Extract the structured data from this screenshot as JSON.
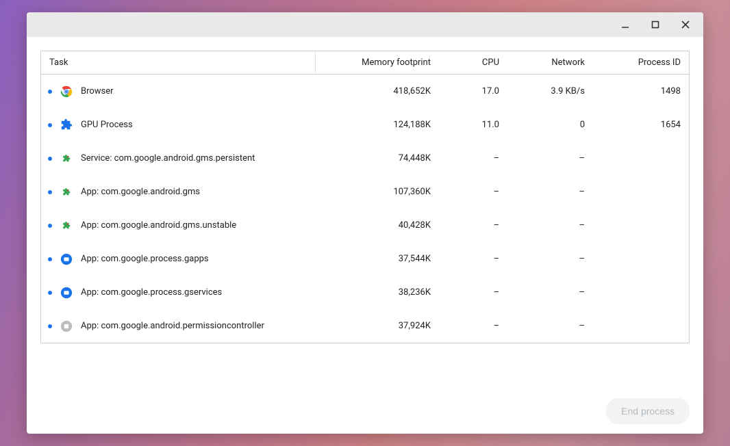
{
  "columns": {
    "task": "Task",
    "memory": "Memory footprint",
    "cpu": "CPU",
    "network": "Network",
    "pid": "Process ID"
  },
  "rows": [
    {
      "icon": "chrome",
      "name": "Browser",
      "memory": "418,652K",
      "cpu": "17.0",
      "network": "3.9 KB/s",
      "pid": "1498"
    },
    {
      "icon": "puzzle",
      "name": "GPU Process",
      "memory": "124,188K",
      "cpu": "11.0",
      "network": "0",
      "pid": "1654"
    },
    {
      "icon": "mini-puzzle",
      "name": "Service: com.google.android.gms.persistent",
      "memory": "74,448K",
      "cpu": "–",
      "network": "–",
      "pid": ""
    },
    {
      "icon": "mini-puzzle",
      "name": "App: com.google.android.gms",
      "memory": "107,360K",
      "cpu": "–",
      "network": "–",
      "pid": ""
    },
    {
      "icon": "mini-puzzle",
      "name": "App: com.google.android.gms.unstable",
      "memory": "40,428K",
      "cpu": "–",
      "network": "–",
      "pid": ""
    },
    {
      "icon": "blue-circle",
      "name": "App: com.google.process.gapps",
      "memory": "37,544K",
      "cpu": "–",
      "network": "–",
      "pid": ""
    },
    {
      "icon": "blue-circle",
      "name": "App: com.google.process.gservices",
      "memory": "38,236K",
      "cpu": "–",
      "network": "–",
      "pid": ""
    },
    {
      "icon": "grey-circle",
      "name": "App: com.google.android.permissioncontroller",
      "memory": "37,924K",
      "cpu": "–",
      "network": "–",
      "pid": ""
    }
  ],
  "footer": {
    "end_process": "End process"
  }
}
